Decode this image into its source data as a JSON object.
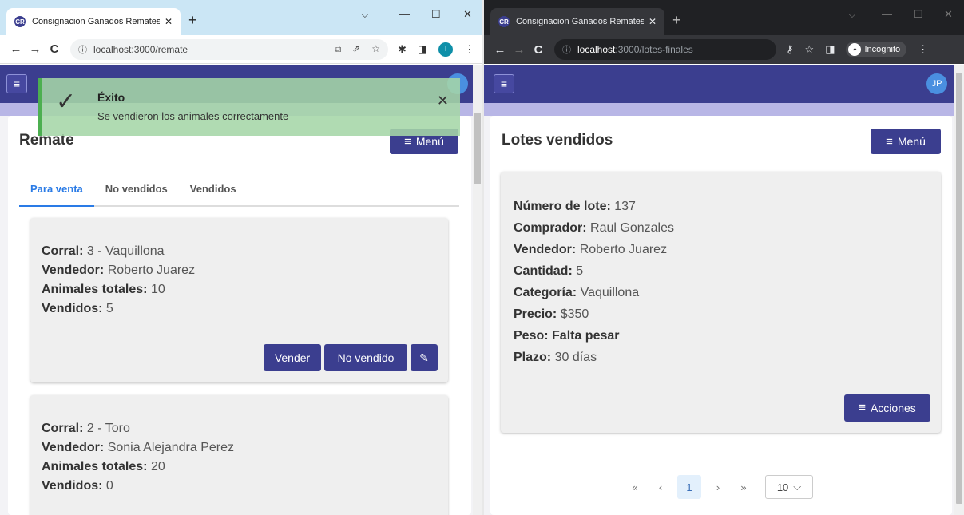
{
  "left": {
    "tab_title": "Consignacion Ganados Remates",
    "url_host": "localhost",
    "url_path": ":3000/remate",
    "profile_initial": "T",
    "toast": {
      "title": "Éxito",
      "message": "Se vendieron los animales correctamente"
    },
    "page_title": "Remate",
    "menu_label": "Menú",
    "tabs": [
      "Para venta",
      "No vendidos",
      "Vendidos"
    ],
    "lots": [
      {
        "corral_label": "Corral:",
        "corral": "3 - Vaquillona",
        "vendedor_label": "Vendedor:",
        "vendedor": "Roberto Juarez",
        "animales_label": "Animales totales:",
        "animales": "10",
        "vendidos_label": "Vendidos:",
        "vendidos": "5"
      },
      {
        "corral_label": "Corral:",
        "corral": "2 - Toro",
        "vendedor_label": "Vendedor:",
        "vendedor": "Sonia Alejandra Perez",
        "animales_label": "Animales totales:",
        "animales": "20",
        "vendidos_label": "Vendidos:",
        "vendidos": "0"
      }
    ],
    "actions": {
      "sell": "Vender",
      "not_sold": "No vendido"
    }
  },
  "right": {
    "tab_title": "Consignacion Ganados Remates",
    "url_host": "localhost",
    "url_path": ":3000/lotes-finales",
    "incognito_label": "Incognito",
    "avatar": "JP",
    "page_title": "Lotes vendidos",
    "menu_label": "Menú",
    "lot": [
      {
        "label": "Número de lote:",
        "value": "137"
      },
      {
        "label": "Comprador:",
        "value": "Raul Gonzales"
      },
      {
        "label": "Vendedor:",
        "value": "Roberto Juarez"
      },
      {
        "label": "Cantidad:",
        "value": "5"
      },
      {
        "label": "Categoría:",
        "value": "Vaquillona"
      },
      {
        "label": "Precio:",
        "value": "$350"
      },
      {
        "label": "Peso: Falta pesar",
        "value": ""
      },
      {
        "label": "Plazo:",
        "value": "30 días"
      }
    ],
    "actions_label": "Acciones",
    "pagination": {
      "first": "«",
      "prev": "‹",
      "current": "1",
      "next": "›",
      "last": "»",
      "page_size": "10"
    }
  },
  "icons": {
    "favicon": "CR",
    "close": "✕",
    "new_tab": "+",
    "minimize": "—",
    "maximize": "☐",
    "window_close": "✕",
    "chevron": "⌵",
    "back": "←",
    "forward": "→",
    "reload": "C",
    "info": "ⓘ",
    "share": "⇗",
    "install": "⧉",
    "star": "☆",
    "puzzle": "✱",
    "sidepanel": "◨",
    "more": "⋮",
    "key": "⚷",
    "incognito": "◓",
    "hamburger": "≡",
    "check": "✓",
    "pencil": "✎",
    "dropdown": "⌵"
  },
  "colors": {
    "primary": "#3b3e8f",
    "tab_active": "#2a7be6",
    "toast_bg": "#a5d6a7",
    "toast_border": "#4caf50",
    "avatar": "#4a8fe0"
  }
}
